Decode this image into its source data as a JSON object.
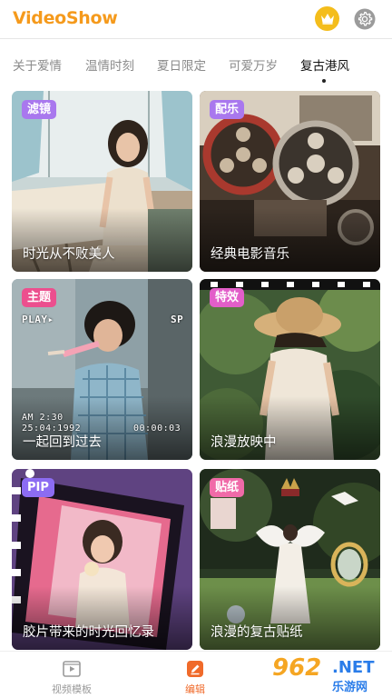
{
  "header": {
    "app_title": "VideoShow",
    "crown_icon": "crown-icon",
    "settings_icon": "gear-icon"
  },
  "tabs": [
    {
      "label": "关于爱情"
    },
    {
      "label": "温情时刻"
    },
    {
      "label": "夏日限定"
    },
    {
      "label": "可爱万岁"
    },
    {
      "label": "复古港风",
      "active": true
    }
  ],
  "cards": [
    {
      "tag": "滤镜",
      "title": "时光从不败美人",
      "tag_color": "#a978ee"
    },
    {
      "tag": "配乐",
      "title": "经典电影音乐",
      "tag_color": "#a978ee"
    },
    {
      "tag": "主题",
      "title": "一起回到过去",
      "tag_color": "#ec4f8e",
      "overlay": {
        "play": "PLAY▸",
        "sp": "SP",
        "time": "AM 2:30",
        "date": "25:04:1992",
        "counter": "00:00:03"
      }
    },
    {
      "tag": "特效",
      "title": "浪漫放映中",
      "tag_color": "#e25ec9"
    },
    {
      "tag": "PIP",
      "title": "胶片带来的时光回忆录",
      "tag_color": "#8c6cf2"
    },
    {
      "tag": "贴纸",
      "title": "浪漫的复古贴纸",
      "tag_color": "#f06aa8"
    }
  ],
  "bottom_nav": [
    {
      "label": "视频模板",
      "icon": "video-template-icon"
    },
    {
      "label": "编辑",
      "icon": "edit-pencil-icon",
      "active": true
    }
  ],
  "watermark": {
    "number": "962",
    "net": ".NET",
    "site": "乐游网"
  },
  "colors": {
    "accent_orange": "#f59a1c",
    "nav_active": "#f06a2a",
    "crown_bg": "#f4bd1b"
  }
}
